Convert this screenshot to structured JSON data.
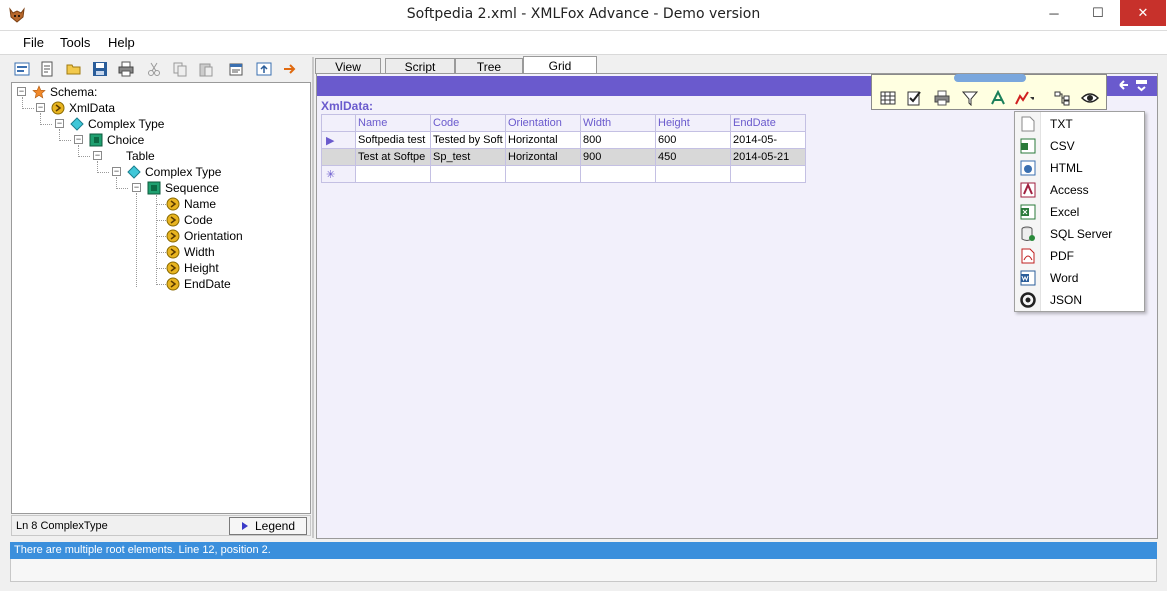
{
  "window": {
    "title": "Softpedia 2.xml - XMLFox Advance - Demo version",
    "minimize": "─",
    "maximize": "☐",
    "close": "✕"
  },
  "menu": [
    "File",
    "Tools",
    "Help"
  ],
  "tree": {
    "schema": "Schema:",
    "xmldata": "XmlData",
    "complex_type_1": "Complex Type",
    "choice": "Choice",
    "table": "Table",
    "complex_type_2": "Complex Type",
    "sequence": "Sequence",
    "fields": [
      "Name",
      "Code",
      "Orientation",
      "Width",
      "Height",
      "EndDate"
    ]
  },
  "status": {
    "line": "Ln 8  ComplexType",
    "legend": "Legend"
  },
  "tabs": [
    "View",
    "Script",
    "Tree",
    "Grid"
  ],
  "active_tab": "Grid",
  "grid": {
    "label": "XmlData:",
    "columns": [
      "Name",
      "Code",
      "Orientation",
      "Width",
      "Height",
      "EndDate"
    ],
    "rows": [
      [
        "Softpedia test",
        "Tested by Soft",
        "Horizontal",
        "800",
        "600",
        "2014-05-"
      ],
      [
        "Test at Softpe",
        "Sp_test",
        "Horizontal",
        "900",
        "450",
        "2014-05-21"
      ]
    ],
    "row_marker": "▶",
    "new_row_marker": "✳"
  },
  "export_menu": [
    "TXT",
    "CSV",
    "HTML",
    "Access",
    "Excel",
    "SQL Server",
    "PDF",
    "Word",
    "JSON"
  ],
  "error": "There are multiple root elements. Line 12, position 2.",
  "colors": {
    "accent": "#6a5acd",
    "error_bar": "#3b8fdc",
    "close_button": "#c7312b"
  }
}
